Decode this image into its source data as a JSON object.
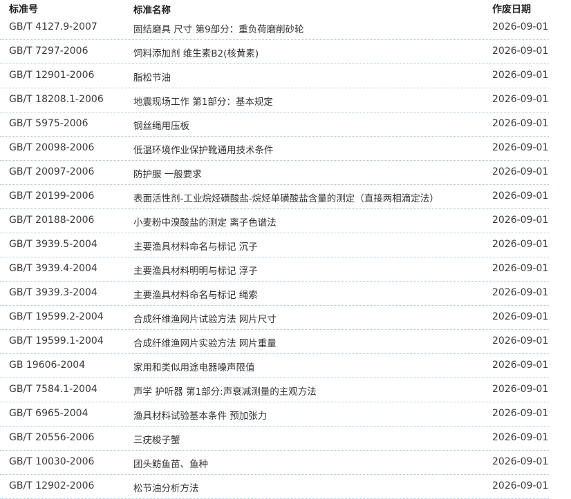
{
  "header": {
    "code": "标准号",
    "name": "标准名称",
    "date": "作废日期"
  },
  "rows": [
    {
      "code": "GB/T 4127.9-2007",
      "name": "固结磨具 尺寸 第9部分：重负荷磨削砂轮",
      "date": "2026-09-01"
    },
    {
      "code": "GB/T 7297-2006",
      "name": "饲料添加剂 维生素B2(核黄素)",
      "date": "2026-09-01"
    },
    {
      "code": "GB/T 12901-2006",
      "name": "脂松节油",
      "date": "2026-09-01"
    },
    {
      "code": "GB/T 18208.1-2006",
      "name": "地震现场工作 第1部分：基本规定",
      "date": "2026-09-01"
    },
    {
      "code": "GB/T 5975-2006",
      "name": "钢丝绳用压板",
      "date": "2026-09-01"
    },
    {
      "code": "GB/T 20098-2006",
      "name": "低温环境作业保护靴通用技术条件",
      "date": "2026-09-01"
    },
    {
      "code": "GB/T 20097-2006",
      "name": "防护服 一般要求",
      "date": "2026-09-01"
    },
    {
      "code": "GB/T 20199-2006",
      "name": "表面活性剂-工业烷烃磺酸盐-烷烃单磺酸盐含量的测定（直接两相滴定法）",
      "date": "2026-09-01"
    },
    {
      "code": "GB/T 20188-2006",
      "name": "小麦粉中溴酸盐的测定 离子色谱法",
      "date": "2026-09-01"
    },
    {
      "code": "GB/T 3939.5-2004",
      "name": "主要渔具材料命名与标记 沉子",
      "date": "2026-09-01"
    },
    {
      "code": "GB/T 3939.4-2004",
      "name": "主要渔具材料明明与标记 浮子",
      "date": "2026-09-01"
    },
    {
      "code": "GB/T 3939.3-2004",
      "name": "主要渔具材料命名与标记 绳索",
      "date": "2026-09-01"
    },
    {
      "code": "GB/T 19599.2-2004",
      "name": "合成纤维渔网片试验方法 网片尺寸",
      "date": "2026-09-01"
    },
    {
      "code": "GB/T 19599.1-2004",
      "name": "合成纤维渔网片实验方法 网片重量",
      "date": "2026-09-01"
    },
    {
      "code": "GB 19606-2004",
      "name": "家用和类似用途电器噪声限值",
      "date": "2026-09-01"
    },
    {
      "code": "GB/T 7584.1-2004",
      "name": "声学 护听器 第1部分:声衰减测量的主观方法",
      "date": "2026-09-01"
    },
    {
      "code": "GB/T 6965-2004",
      "name": "渔具材料试验基本条件 预加张力",
      "date": "2026-09-01"
    },
    {
      "code": "GB/T 20556-2006",
      "name": "三疣梭子蟹",
      "date": "2026-09-01"
    },
    {
      "code": "GB/T 10030-2006",
      "name": "团头鲂鱼苗、鱼种",
      "date": "2026-09-01"
    },
    {
      "code": "GB/T 12902-2006",
      "name": "松节油分析方法",
      "date": "2026-09-01"
    }
  ]
}
